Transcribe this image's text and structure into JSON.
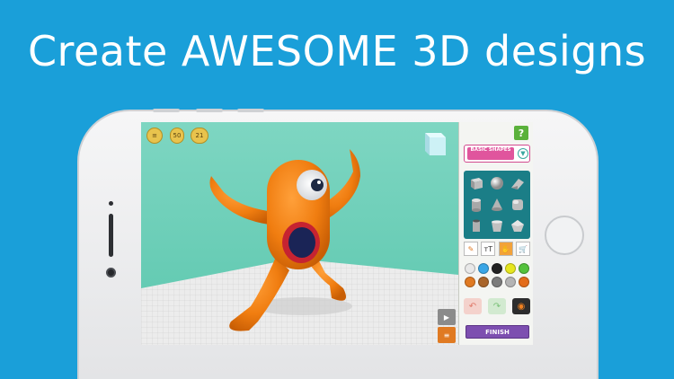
{
  "headline": "Create AWESOME 3D designs",
  "viewport": {
    "badges": [
      {
        "name": "coin-menu-badge",
        "label": ""
      },
      {
        "name": "level-badge",
        "label": "50"
      },
      {
        "name": "points-badge",
        "label": "21"
      }
    ],
    "side_tabs": [
      "play-icon",
      "layers-icon"
    ]
  },
  "panel": {
    "help_label": "?",
    "category_label": "BASIC SHAPES",
    "shapes": [
      "cube-shape-icon",
      "sphere-shape-icon",
      "wedge-shape-icon",
      "cylinder-shape-icon",
      "cone-shape-icon",
      "cube-rounded-shape-icon",
      "tube-shape-icon",
      "cup-shape-icon",
      "gem-shape-icon"
    ],
    "tools": [
      "pencil-icon",
      "text-icon",
      "hand-icon",
      "cart-icon"
    ],
    "tool_labels": [
      "✎",
      "ᴛT",
      "✋",
      "🛒"
    ],
    "colors": [
      "#e8e8e8",
      "#3aa6e6",
      "#222222",
      "#e6e61e",
      "#54c23c",
      "#e07a22",
      "#a9652a",
      "#7c7c7c",
      "#b4b4b4",
      "#e36c1a"
    ],
    "actions": [
      "undo-icon",
      "redo-icon",
      "camera-icon"
    ],
    "finish_label": "FINISH"
  }
}
